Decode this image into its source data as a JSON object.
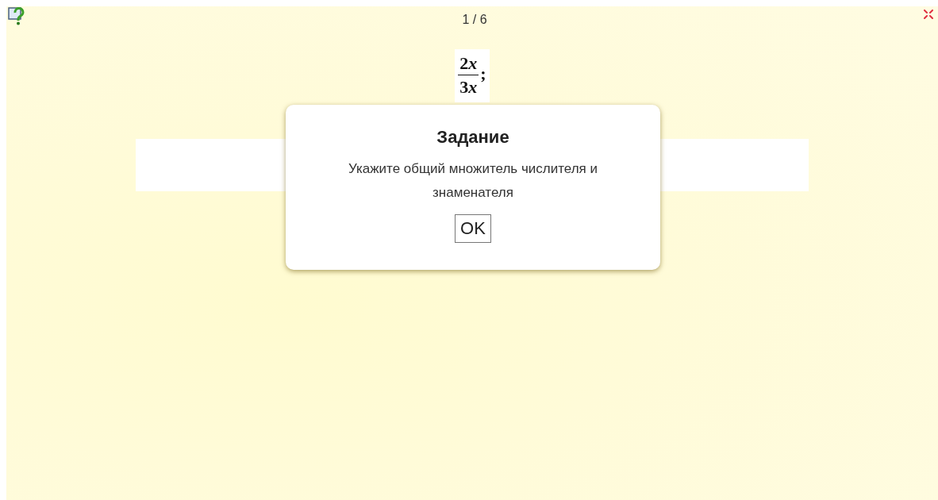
{
  "counter": "1 / 6",
  "fraction": {
    "numerator": {
      "coefficient": "2",
      "variable": "x"
    },
    "denominator": {
      "coefficient": "3",
      "variable": "x"
    },
    "separator": ";"
  },
  "dialog": {
    "title": "Задание",
    "message": "Укажите общий множитель числителя и знаменателя",
    "button": "OK"
  }
}
